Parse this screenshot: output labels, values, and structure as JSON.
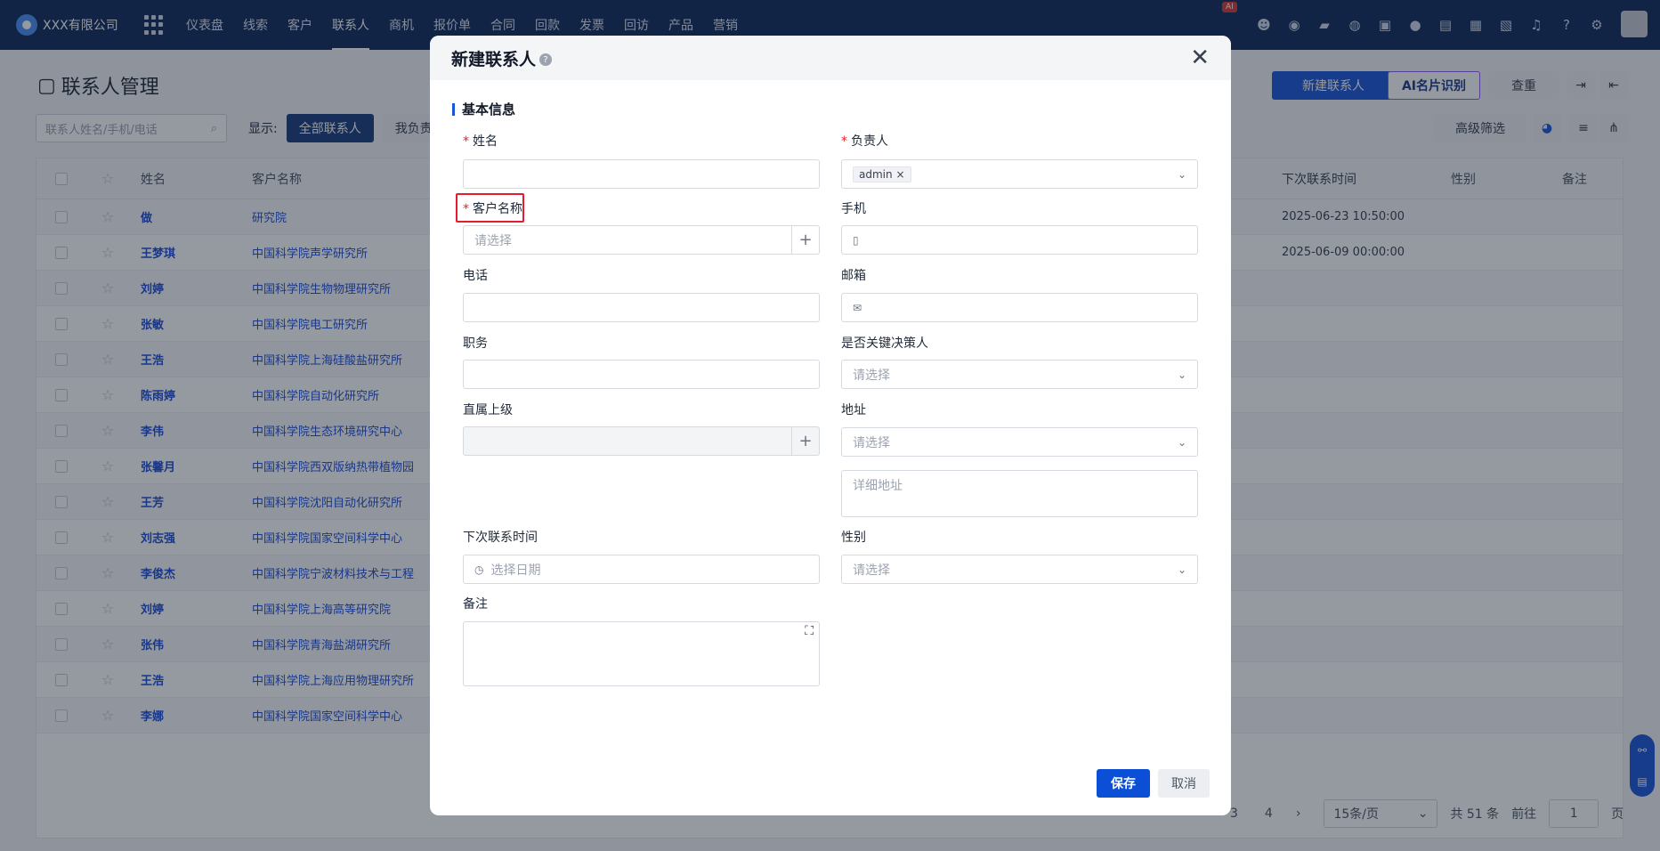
{
  "topnav": {
    "company": "XXX有限公司",
    "items": [
      "仪表盘",
      "线索",
      "客户",
      "联系人",
      "商机",
      "报价单",
      "合同",
      "回款",
      "发票",
      "回访",
      "产品",
      "营销"
    ],
    "active_index": 3,
    "ai_badge": "AI"
  },
  "page": {
    "title": "联系人管理",
    "buttons": {
      "new": "新建联系人",
      "ai_card": "AI名片识别",
      "dedupe": "查重",
      "advanced_filter": "高级筛选"
    },
    "search_placeholder": "联系人姓名/手机/电话",
    "show_label": "显示:",
    "chips": [
      "全部联系人",
      "我负责"
    ]
  },
  "table": {
    "headers": {
      "name": "姓名",
      "customer": "客户名称",
      "next_contact": "下次联系时间",
      "gender": "性别",
      "note": "备注"
    },
    "rows": [
      {
        "name": "做",
        "customer": "研究院",
        "next": "2025-06-23 10:50:00"
      },
      {
        "name": "王梦琪",
        "customer": "中国科学院声学研究所",
        "next": "2025-06-09 00:00:00"
      },
      {
        "name": "刘婷",
        "customer": "中国科学院生物物理研究所",
        "next": ""
      },
      {
        "name": "张敏",
        "customer": "中国科学院电工研究所",
        "next": ""
      },
      {
        "name": "王浩",
        "customer": "中国科学院上海硅酸盐研究所",
        "next": ""
      },
      {
        "name": "陈雨婷",
        "customer": "中国科学院自动化研究所",
        "next": ""
      },
      {
        "name": "李伟",
        "customer": "中国科学院生态环境研究中心",
        "next": ""
      },
      {
        "name": "张馨月",
        "customer": "中国科学院西双版纳热带植物园",
        "next": ""
      },
      {
        "name": "王芳",
        "customer": "中国科学院沈阳自动化研究所",
        "next": ""
      },
      {
        "name": "刘志强",
        "customer": "中国科学院国家空间科学中心",
        "next": ""
      },
      {
        "name": "李俊杰",
        "customer": "中国科学院宁波材料技术与工程",
        "next": ""
      },
      {
        "name": "刘婷",
        "customer": "中国科学院上海高等研究院",
        "next": ""
      },
      {
        "name": "张伟",
        "customer": "中国科学院青海盐湖研究所",
        "next": ""
      },
      {
        "name": "王浩",
        "customer": "中国科学院上海应用物理研究所",
        "next": ""
      },
      {
        "name": "李娜",
        "customer": "中国科学院国家空间科学中心",
        "next": ""
      }
    ]
  },
  "pagination": {
    "page3": "3",
    "page4": "4",
    "page_size": "15条/页",
    "total": "共 51 条",
    "goto": "前往",
    "goto_value": "1",
    "page_unit": "页"
  },
  "modal": {
    "title": "新建联系人",
    "section": "基本信息",
    "fields": {
      "name": "姓名",
      "owner": "负责人",
      "owner_tag": "admin",
      "customer": "客户名称",
      "customer_placeholder": "请选择",
      "mobile": "手机",
      "phone": "电话",
      "email": "邮箱",
      "position": "职务",
      "key_decision": "是否关键决策人",
      "key_decision_placeholder": "请选择",
      "superior": "直属上级",
      "address": "地址",
      "address_placeholder": "请选择",
      "address_detail_placeholder": "详细地址",
      "next_contact": "下次联系时间",
      "next_contact_placeholder": "选择日期",
      "gender": "性别",
      "gender_placeholder": "请选择",
      "note": "备注"
    },
    "save": "保存",
    "cancel": "取消"
  }
}
